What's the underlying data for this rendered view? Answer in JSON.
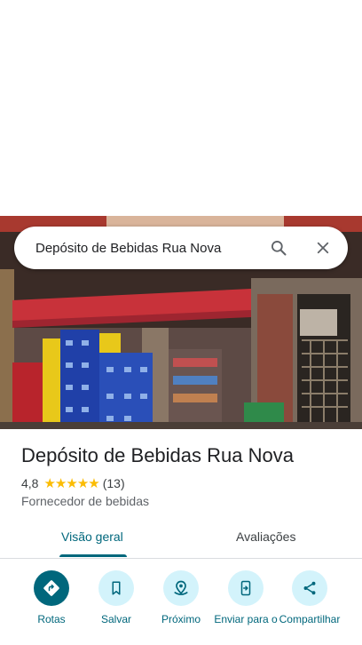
{
  "search": {
    "query": "Depósito de Bebidas Rua Nova"
  },
  "place": {
    "name": "Depósito de Bebidas Rua Nova",
    "rating": "4,8",
    "stars": 5,
    "review_count": "(13)",
    "category": "Fornecedor de bebidas"
  },
  "tabs": [
    {
      "label": "Visão geral",
      "selected": true
    },
    {
      "label": "Avaliações",
      "selected": false
    }
  ],
  "actions": [
    {
      "label": "Rotas",
      "icon": "directions-icon"
    },
    {
      "label": "Salvar",
      "icon": "bookmark-icon"
    },
    {
      "label": "Próximo",
      "icon": "nearby-icon"
    },
    {
      "label": "Enviar para o",
      "icon": "send-to-phone-icon"
    },
    {
      "label": "Compartilhar",
      "icon": "share-icon"
    }
  ],
  "colors": {
    "accent": "#00677c",
    "accent_light": "#d3f3fb",
    "star": "#fbbc04"
  }
}
